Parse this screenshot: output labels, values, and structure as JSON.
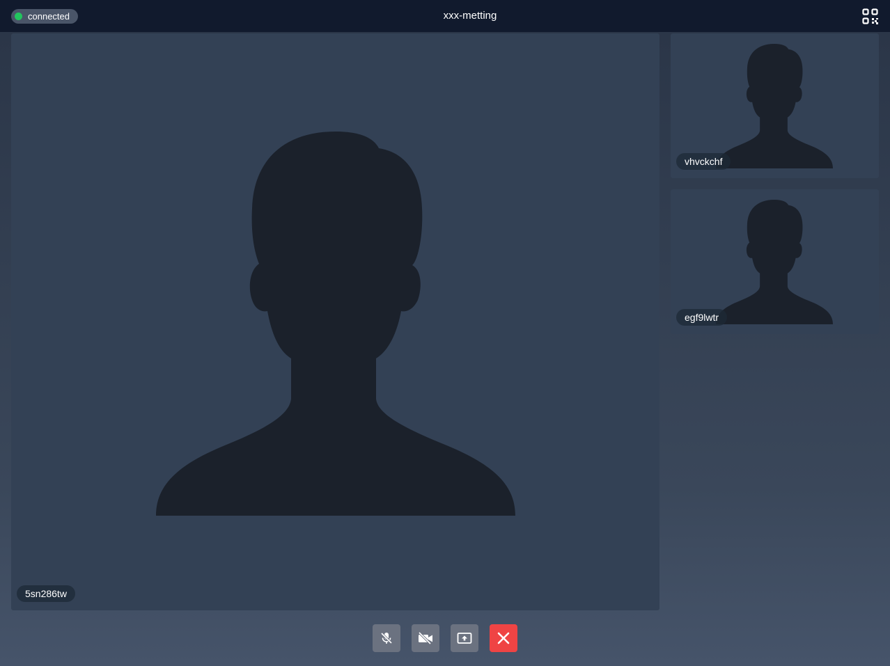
{
  "header": {
    "status": "connected",
    "meeting_title": "xxx-metting",
    "status_color": "#22c55e",
    "qr_icon": "qr-code-icon"
  },
  "participants": {
    "main": {
      "name": "5sn286tw",
      "avatar_icon": "person-silhouette-icon"
    },
    "side": [
      {
        "name": "vhvckchf",
        "avatar_icon": "person-silhouette-icon"
      },
      {
        "name": "egf9lwtr",
        "avatar_icon": "person-silhouette-icon"
      }
    ]
  },
  "controls": {
    "icons": [
      "mic-off-icon",
      "video-off-icon",
      "screen-share-icon",
      "close-icon"
    ],
    "hangup_color": "#ef4444"
  },
  "colors": {
    "header_bg": "#111a2d",
    "tile_bg": "#334155",
    "silhouette": "#1b212b",
    "button_bg": "#6b7280"
  }
}
